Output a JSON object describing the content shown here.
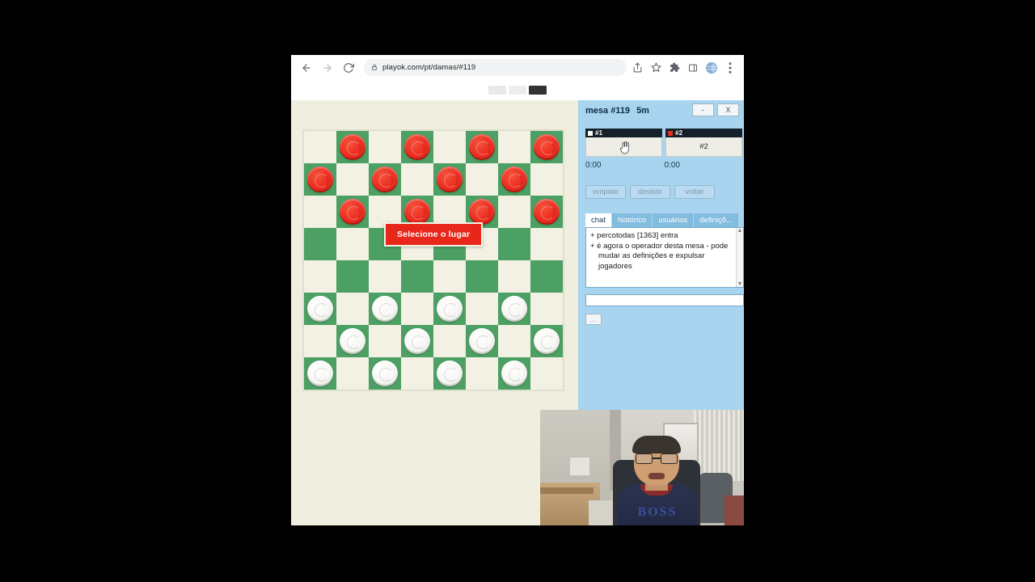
{
  "browser": {
    "back_icon": "back-arrow-icon",
    "forward_icon": "forward-arrow-icon",
    "reload_icon": "reload-icon",
    "lock_icon": "lock-icon",
    "url": "playok.com/pt/damas/#119",
    "toolbar_icons": [
      "share-icon",
      "bookmark-star-icon",
      "extensions-puzzle-icon",
      "side-panel-icon",
      "profile-avatar-icon",
      "three-dot-menu-icon"
    ]
  },
  "page_topstrip": {
    "buttons": [
      "",
      "",
      ""
    ]
  },
  "game": {
    "banner_text": "Selecione o lugar",
    "board": {
      "size": 8,
      "light_color": "#f2f1e3",
      "dark_color": "#4ca064",
      "red_piece_color": "#ed3124",
      "white_piece_color": "#f7f7f5",
      "rows": [
        [
          "",
          "r",
          "",
          "r",
          "",
          "r",
          "",
          "r"
        ],
        [
          "r",
          "",
          "r",
          "",
          "r",
          "",
          "r",
          ""
        ],
        [
          "",
          "r",
          "",
          "r",
          "",
          "r",
          "",
          "r"
        ],
        [
          "",
          "",
          "",
          "",
          "",
          "",
          "",
          ""
        ],
        [
          "",
          "",
          "",
          "",
          "",
          "",
          "",
          ""
        ],
        [
          "w",
          "",
          "w",
          "",
          "w",
          "",
          "w",
          ""
        ],
        [
          "",
          "w",
          "",
          "w",
          "",
          "w",
          "",
          "w"
        ],
        [
          "w",
          "",
          "w",
          "",
          "w",
          "",
          "w",
          ""
        ]
      ]
    }
  },
  "panel": {
    "title": "mesa #119",
    "timer": "5m",
    "minimize_label": "-",
    "close_label": "X",
    "seats": [
      {
        "name": "#1",
        "color": "white",
        "occupant": "",
        "clock": "0:00"
      },
      {
        "name": "#2",
        "color": "red",
        "occupant": "#2",
        "clock": "0:00"
      }
    ],
    "actions": [
      "empate",
      "desistir",
      "voltar"
    ],
    "tabs": [
      {
        "label": "chat",
        "active": true
      },
      {
        "label": "histórico",
        "active": false
      },
      {
        "label": "usuários",
        "active": false
      },
      {
        "label": "definiçõ...",
        "active": false
      }
    ],
    "chat_messages": [
      "+ percotodas [1363] entra",
      "+ é agora o operador desta mesa - pode mudar as definições e expulsar jogadores"
    ],
    "chat_input_value": "",
    "more_button_label": "...",
    "scroll_up": "▲",
    "scroll_down": "▼",
    "background_color": "#a8d4ef"
  },
  "webcam": {
    "shirt_text": "BOSS"
  }
}
